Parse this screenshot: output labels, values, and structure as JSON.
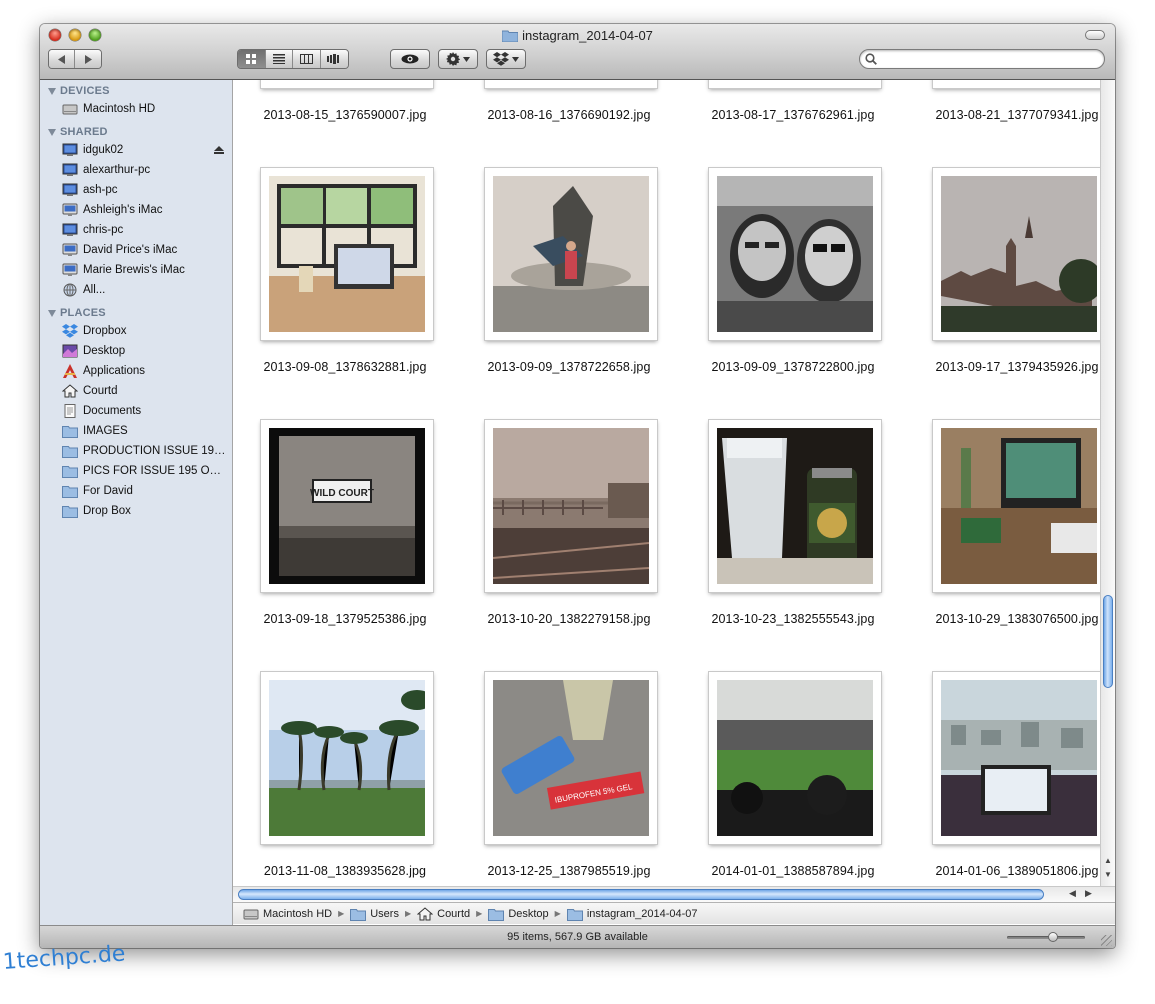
{
  "window": {
    "title": "instagram_2014-04-07",
    "search_placeholder": ""
  },
  "sidebar": {
    "sections": [
      {
        "header": "DEVICES",
        "items": [
          {
            "label": "Macintosh HD",
            "icon": "hard-disk-icon"
          }
        ]
      },
      {
        "header": "SHARED",
        "items": [
          {
            "label": "idguk02",
            "icon": "network-computer-icon"
          },
          {
            "label": "alexarthur-pc",
            "icon": "network-computer-icon"
          },
          {
            "label": "ash-pc",
            "icon": "network-computer-icon"
          },
          {
            "label": "Ashleigh's iMac",
            "icon": "imac-icon"
          },
          {
            "label": "chris-pc",
            "icon": "network-computer-icon"
          },
          {
            "label": "David Price's iMac",
            "icon": "imac-icon"
          },
          {
            "label": "Marie Brewis's iMac",
            "icon": "imac-icon"
          },
          {
            "label": "All...",
            "icon": "network-globe-icon"
          }
        ]
      },
      {
        "header": "PLACES",
        "items": [
          {
            "label": "Dropbox",
            "icon": "dropbox-icon"
          },
          {
            "label": "Desktop",
            "icon": "desktop-icon"
          },
          {
            "label": "Applications",
            "icon": "applications-icon"
          },
          {
            "label": "Courtd",
            "icon": "home-icon"
          },
          {
            "label": "Documents",
            "icon": "documents-icon"
          },
          {
            "label": "IMAGES",
            "icon": "folder-icon"
          },
          {
            "label": "PRODUCTION ISSUE 195 ...",
            "icon": "folder-icon"
          },
          {
            "label": "PICS FOR ISSUE 195 OCT...",
            "icon": "folder-icon"
          },
          {
            "label": "For David",
            "icon": "folder-icon"
          },
          {
            "label": "Drop Box",
            "icon": "folder-icon"
          }
        ]
      }
    ]
  },
  "files": [
    "2013-08-15_1376590007.jpg",
    "2013-08-16_1376690192.jpg",
    "2013-08-17_1376762961.jpg",
    "2013-08-21_1377079341.jpg",
    "2013-09-08_1378632881.jpg",
    "2013-09-09_1378722658.jpg",
    "2013-09-09_1378722800.jpg",
    "2013-09-17_1379435926.jpg",
    "2013-09-18_1379525386.jpg",
    "2013-10-20_1382279158.jpg",
    "2013-10-23_1382555543.jpg",
    "2013-10-29_1383076500.jpg",
    "2013-11-08_1383935628.jpg",
    "2013-12-25_1387985519.jpg",
    "2014-01-01_1388587894.jpg",
    "2014-01-06_1389051806.jpg"
  ],
  "pathbar": [
    "Macintosh HD",
    "Users",
    "Courtd",
    "Desktop",
    "instagram_2014-04-07"
  ],
  "status": {
    "text": "95 items, 567.9 GB available",
    "zoom_level": 0.6
  },
  "watermark": "1techpc.de"
}
